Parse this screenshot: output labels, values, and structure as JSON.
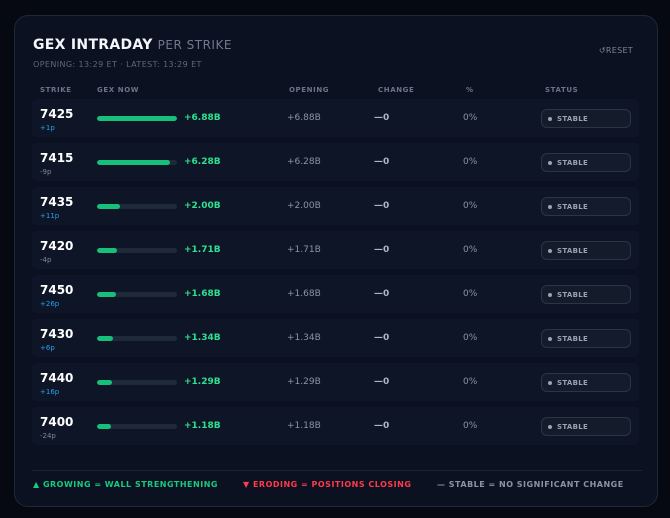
{
  "header": {
    "title": "GEX INTRADAY",
    "subtitle": "PER STRIKE",
    "times": "OPENING: 13:29 ET · LATEST: 13:29 ET",
    "reset_icon": "↺",
    "reset_label": "RESET"
  },
  "columns": {
    "strike": "STRIKE",
    "gex_now": "GEX NOW",
    "opening": "OPENING",
    "change": "CHANGE",
    "pct": "%",
    "status": "STATUS"
  },
  "rows": [
    {
      "strike": "7425",
      "delta": "+1p",
      "delta_color": "#2a9fe8",
      "gex_fraction": 1.0,
      "gex": "+6.88B",
      "opening": "+6.88B",
      "change": "—0",
      "pct": "0%",
      "status": "STABLE"
    },
    {
      "strike": "7415",
      "delta": "-9p",
      "delta_color": "#7d8798",
      "gex_fraction": 0.91,
      "gex": "+6.28B",
      "opening": "+6.28B",
      "change": "—0",
      "pct": "0%",
      "status": "STABLE"
    },
    {
      "strike": "7435",
      "delta": "+11p",
      "delta_color": "#2a9fe8",
      "gex_fraction": 0.29,
      "gex": "+2.00B",
      "opening": "+2.00B",
      "change": "—0",
      "pct": "0%",
      "status": "STABLE"
    },
    {
      "strike": "7420",
      "delta": "-4p",
      "delta_color": "#7d8798",
      "gex_fraction": 0.25,
      "gex": "+1.71B",
      "opening": "+1.71B",
      "change": "—0",
      "pct": "0%",
      "status": "STABLE"
    },
    {
      "strike": "7450",
      "delta": "+26p",
      "delta_color": "#2a9fe8",
      "gex_fraction": 0.24,
      "gex": "+1.68B",
      "opening": "+1.68B",
      "change": "—0",
      "pct": "0%",
      "status": "STABLE"
    },
    {
      "strike": "7430",
      "delta": "+6p",
      "delta_color": "#2a9fe8",
      "gex_fraction": 0.2,
      "gex": "+1.34B",
      "opening": "+1.34B",
      "change": "—0",
      "pct": "0%",
      "status": "STABLE"
    },
    {
      "strike": "7440",
      "delta": "+16p",
      "delta_color": "#2a9fe8",
      "gex_fraction": 0.19,
      "gex": "+1.29B",
      "opening": "+1.29B",
      "change": "—0",
      "pct": "0%",
      "status": "STABLE"
    },
    {
      "strike": "7400",
      "delta": "-24p",
      "delta_color": "#7d8798",
      "gex_fraction": 0.17,
      "gex": "+1.18B",
      "opening": "+1.18B",
      "change": "—0",
      "pct": "0%",
      "status": "STABLE"
    }
  ],
  "legend": {
    "growing": "▲ GROWING = WALL STRENGTHENING",
    "eroding": "▼ ERODING = POSITIONS CLOSING",
    "stable": "— STABLE = NO SIGNIFICANT CHANGE"
  },
  "colors": {
    "growing": "#19c97f",
    "eroding": "#ff3b4a",
    "stable": "#8a94a4",
    "bar": "#16c07a"
  }
}
